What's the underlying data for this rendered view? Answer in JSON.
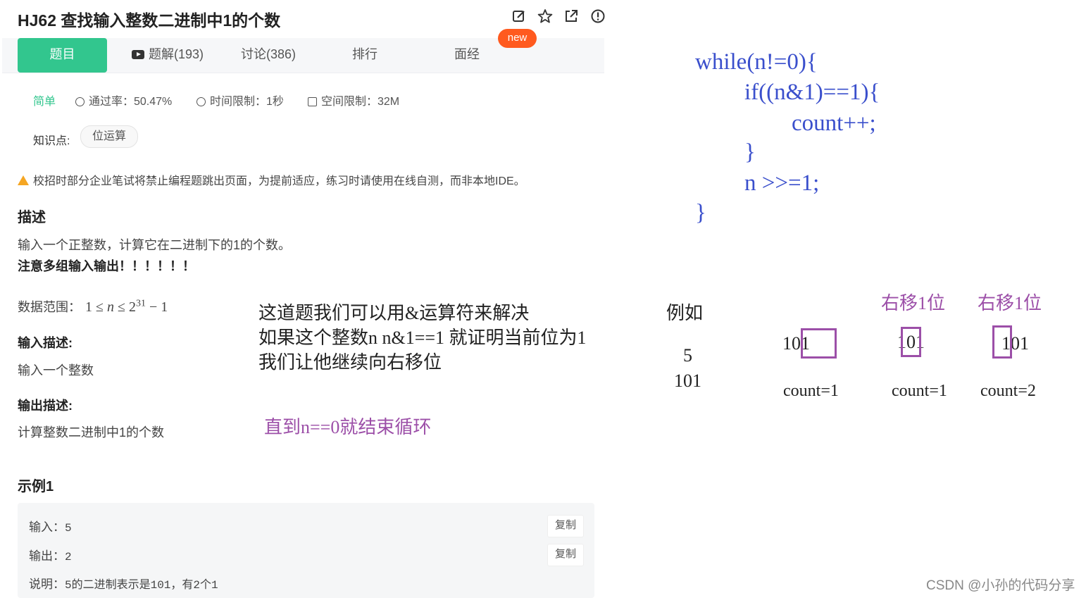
{
  "problem": {
    "title": "HJ62  查找输入整数二进制中1的个数",
    "icons": [
      "edit-icon",
      "star-icon",
      "share-icon",
      "report-icon"
    ],
    "tabs": [
      "题目",
      "题解(193)",
      "讨论(386)",
      "排行",
      "面经"
    ],
    "new_badge": "new",
    "difficulty": "简单",
    "pass_rate": "通过率：50.47%",
    "time_limit": "时间限制：1秒",
    "space_limit": "空间限制：32M",
    "knowledge_label": "知识点:",
    "knowledge_tag": "位运算",
    "notice": "校招时部分企业笔试将禁止编程题跳出页面，为提前适应，练习时请使用在线自测，而非本地IDE。",
    "desc_heading": "描述",
    "desc_line1": "输入一个正整数，计算它在二进制下的1的个数。",
    "desc_line2": "注意多组输入输出！！！！！！",
    "range_label": "数据范围：",
    "range_one": "1",
    "range_n": "n",
    "range_two": "2",
    "range_exp": "31",
    "range_minus": "− 1",
    "input_heading": "输入描述:",
    "input_text": "输入一个整数",
    "output_heading": "输出描述:",
    "output_text": "计算整数二进制中1的个数",
    "example_heading": "示例1",
    "example": {
      "input_label": "输入：",
      "input_value": "5",
      "output_label": "输出：",
      "output_value": "2",
      "note_label": "说明：",
      "note_value": "5的二进制表示是101，有2个1",
      "copy": "复制"
    }
  },
  "annotations": {
    "note_line1": "这道题我们可以用&运算符来解决",
    "note_line2": "如果这个整数n  n&1==1  就证明当前位为1",
    "note_line3": "我们让他继续向右移位",
    "note_loop_end": "直到n==0就结束循环",
    "code": [
      "while(n!=0){",
      "if((n&1)==1){",
      "count++;",
      "}",
      "n >>=1;",
      "}"
    ],
    "example_label": "例如",
    "example_num": "5",
    "example_bin": "101",
    "shift_label": "右移1位",
    "step_bin": "101",
    "count1": "count=1",
    "count2": "count=1",
    "count3": "count=2"
  },
  "watermark": "CSDN @小孙的代码分享",
  "colors": {
    "accent": "#32c68e",
    "badge": "#ff5a1f",
    "code": "#3a4fcc",
    "purple": "#9c4fa8"
  }
}
